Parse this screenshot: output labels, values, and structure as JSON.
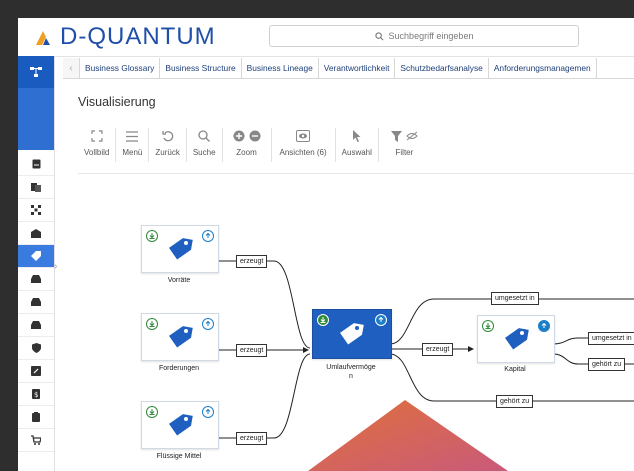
{
  "app": {
    "logo_text": "D-QUANTUM"
  },
  "search": {
    "placeholder": "Suchbegriff eingeben"
  },
  "tabs": [
    {
      "label": "Business Glossary"
    },
    {
      "label": "Business Structure"
    },
    {
      "label": "Business Lineage"
    },
    {
      "label": "Verantwortlichkeit"
    },
    {
      "label": "Schutzbedarfsanalyse"
    },
    {
      "label": "Anforderungsmanagemen"
    }
  ],
  "page": {
    "title": "Visualisierung"
  },
  "toolbar": {
    "vollbild": "Vollbild",
    "menu": "Menü",
    "zurueck": "Zurück",
    "suche": "Suche",
    "zoom": "Zoom",
    "ansichten": "Ansichten (6)",
    "auswahl": "Auswahl",
    "filter": "Filter"
  },
  "nodes": {
    "vorraete": "Vorräte",
    "forderungen": "Forderungen",
    "fluessige_mittel": "Flüssige Mittel",
    "umlaufvermoegen": "Umlaufvermöge\nn",
    "kapital": "Kapital"
  },
  "edges": {
    "erzeugt_1": "erzeugt",
    "erzeugt_2": "erzeugt",
    "erzeugt_3": "erzeugt",
    "erzeugt_4": "erzeugt",
    "umgesetzt_in_1": "umgesetzt in",
    "umgesetzt_in_2": "umgesetzt in",
    "gehoert_zu_1": "gehört zu",
    "gehoert_zu_2": "gehört zu"
  },
  "colors": {
    "brand": "#1f4fa8",
    "accent": "#2f6fd1",
    "download": "#2f8a3a",
    "upload": "#1b7fc7"
  }
}
